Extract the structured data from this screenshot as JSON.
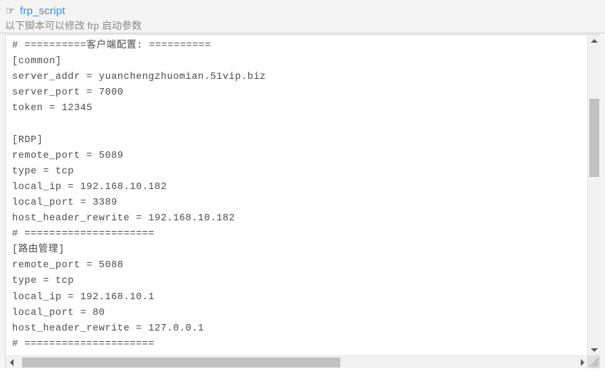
{
  "header": {
    "icon": "pointing-hand-icon",
    "icon_glyph": "☞",
    "title": "frp_script",
    "title_color": "#3a8ee6",
    "subtitle": "以下脚本可以修改 frp 启动参数",
    "subtitle_color": "#8a8a8a"
  },
  "editor": {
    "name": "frp-config-script",
    "language": "ini",
    "readonly_appearance": true,
    "code": "# ==========客户端配置: ==========\n[common]\nserver_addr = yuanchengzhuomian.51vip.biz\nserver_port = 7000\ntoken = 12345\n\n[RDP]\nremote_port = 5089\ntype = tcp\nlocal_ip = 192.168.10.182\nlocal_port = 3389\nhost_header_rewrite = 192.168.10.182\n# =====================\n[路由管理]\nremote_port = 5088\ntype = tcp\nlocal_ip = 192.168.10.1\nlocal_port = 80\nhost_header_rewrite = 127.0.0.1\n# =====================",
    "lines": [
      "# ==========客户端配置: ==========",
      "[common]",
      "server_addr = yuanchengzhuomian.51vip.biz",
      "server_port = 7000",
      "token = 12345",
      "",
      "[RDP]",
      "remote_port = 5089",
      "type = tcp",
      "local_ip = 192.168.10.182",
      "local_port = 3389",
      "host_header_rewrite = 192.168.10.182",
      "# =====================",
      "[路由管理]",
      "remote_port = 5088",
      "type = tcp",
      "local_ip = 192.168.10.1",
      "local_port = 80",
      "host_header_rewrite = 127.0.0.1",
      "# ====================="
    ],
    "sections": [
      {
        "name": "common",
        "entries": [
          {
            "key": "server_addr",
            "value": "yuanchengzhuomian.51vip.biz"
          },
          {
            "key": "server_port",
            "value": "7000"
          },
          {
            "key": "token",
            "value": "12345"
          }
        ]
      },
      {
        "name": "RDP",
        "entries": [
          {
            "key": "remote_port",
            "value": "5089"
          },
          {
            "key": "type",
            "value": "tcp"
          },
          {
            "key": "local_ip",
            "value": "192.168.10.182"
          },
          {
            "key": "local_port",
            "value": "3389"
          },
          {
            "key": "host_header_rewrite",
            "value": "192.168.10.182"
          }
        ]
      },
      {
        "name": "路由管理",
        "entries": [
          {
            "key": "remote_port",
            "value": "5088"
          },
          {
            "key": "type",
            "value": "tcp"
          },
          {
            "key": "local_ip",
            "value": "192.168.10.1"
          },
          {
            "key": "local_port",
            "value": "80"
          },
          {
            "key": "host_header_rewrite",
            "value": "127.0.0.1"
          }
        ]
      }
    ],
    "text_color": "#4a4a52",
    "background": "#ffffff"
  },
  "scrollbars": {
    "vertical": {
      "up_arrow": "scroll-up-arrow-icon",
      "down_arrow": "scroll-down-arrow-icon",
      "thumb_top_pct": 20,
      "thumb_size_pct": 24
    },
    "horizontal": {
      "left_arrow": "scroll-left-arrow-icon",
      "right_arrow": "scroll-right-arrow-icon",
      "thumb_left_pct": 3,
      "thumb_size_pct": 56
    },
    "resize_grip": "resize-grip-icon",
    "track_color": "#f1f1f1",
    "thumb_color": "#c1c1c1"
  }
}
